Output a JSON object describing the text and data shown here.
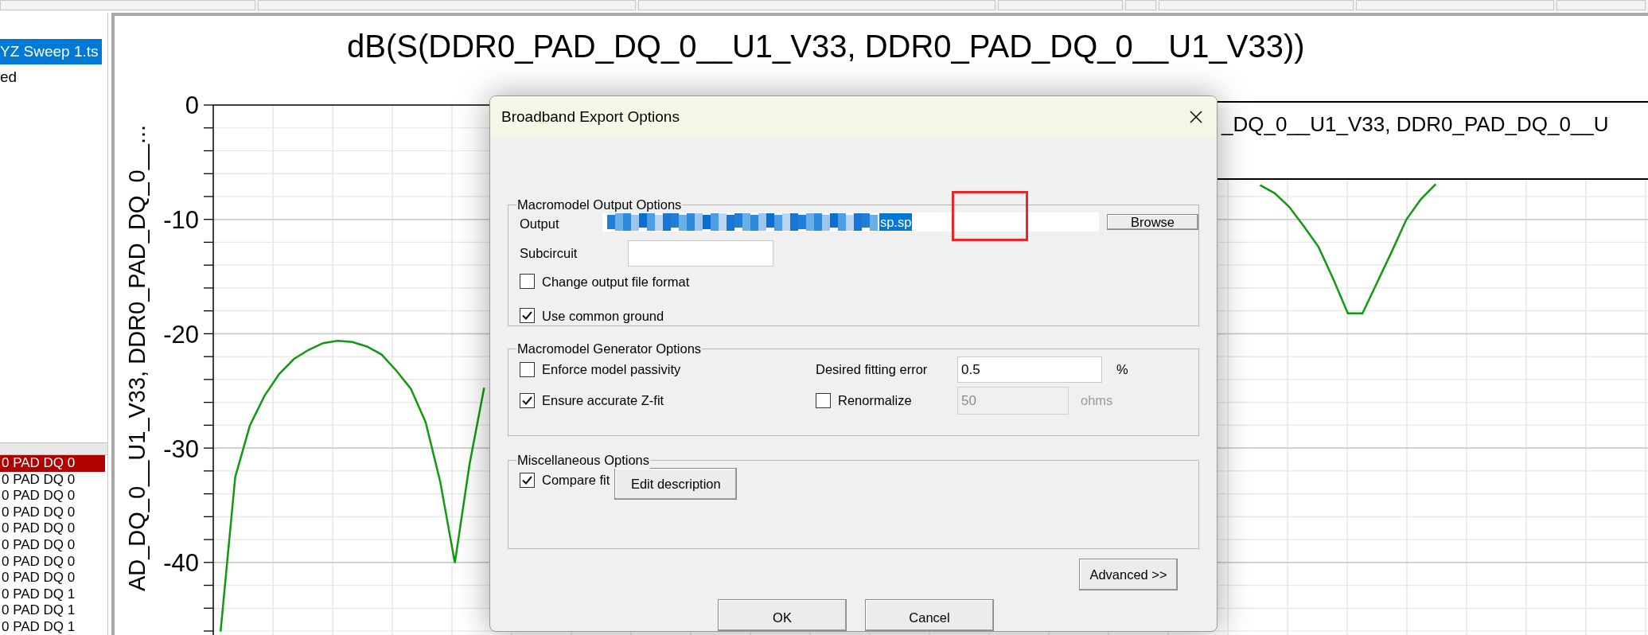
{
  "sidebar": {
    "items": [
      {
        "label": "YZ Sweep 1.ts",
        "selected": true
      },
      {
        "label": "ed",
        "selected": false
      }
    ]
  },
  "net_list": {
    "items": [
      {
        "label": "0 PAD DQ 0",
        "selected": true
      },
      {
        "label": "0 PAD DQ 0",
        "selected": false
      },
      {
        "label": "0 PAD DQ 0",
        "selected": false
      },
      {
        "label": "0 PAD DQ 0",
        "selected": false
      },
      {
        "label": "0 PAD DQ 0",
        "selected": false
      },
      {
        "label": "0 PAD DQ 0",
        "selected": false
      },
      {
        "label": "0 PAD DQ 0",
        "selected": false
      },
      {
        "label": "0 PAD DQ 0",
        "selected": false
      },
      {
        "label": "0 PAD DQ 1",
        "selected": false
      },
      {
        "label": "0 PAD DQ 1",
        "selected": false
      },
      {
        "label": "0 PAD DQ 1",
        "selected": false
      }
    ]
  },
  "chart": {
    "chart_data": {
      "type": "line",
      "title": "dB(S(DDR0_PAD_DQ_0__U1_V33, DDR0_PAD_DQ_0__U1_V33))",
      "ylabel": "AD_DQ_0__U1_V33, DDR0_PAD_DQ_0__...",
      "ylim": [
        -46.3,
        0
      ],
      "yticks": [
        0,
        -10,
        -20,
        -30,
        -40
      ],
      "grid": true,
      "categories": [
        null,
        null,
        null,
        null,
        null,
        null,
        null,
        null,
        null,
        null,
        null,
        null,
        null,
        null,
        null,
        null,
        null,
        null,
        null,
        null,
        null,
        null,
        null,
        null,
        null,
        null,
        null,
        null,
        null,
        null,
        null,
        null,
        null,
        null,
        null,
        null,
        null,
        null,
        null,
        null,
        null,
        null,
        null,
        null,
        null,
        null,
        null,
        null,
        null,
        null,
        null,
        null,
        null,
        null,
        null,
        null,
        null,
        null,
        null,
        null,
        null,
        null,
        null,
        null,
        null,
        null,
        null,
        null,
        null,
        null,
        null,
        null,
        null,
        null,
        null,
        null,
        null,
        null,
        null,
        null,
        null,
        null,
        null,
        null,
        null,
        null,
        null,
        null,
        null,
        null,
        null,
        null,
        null,
        null,
        null,
        null,
        null,
        null
      ],
      "series": [
        {
          "name": "_DQ_0__U1_V33, DDR0_PAD_DQ_0__U",
          "color": "#119911",
          "values": [
            -46,
            -32.5,
            -28,
            -25.4,
            -23.5,
            -22.2,
            -21.4,
            -20.8,
            -20.6,
            -20.7,
            -21.1,
            -21.8,
            -23.2,
            -24.8,
            -27.7,
            -32.9,
            -40,
            -31.4,
            -24.7,
            null,
            null,
            null,
            null,
            null,
            null,
            null,
            null,
            null,
            null,
            null,
            null,
            null,
            null,
            null,
            null,
            null,
            null,
            null,
            null,
            null,
            null,
            null,
            null,
            null,
            null,
            null,
            null,
            null,
            null,
            null,
            null,
            null,
            null,
            null,
            null,
            null,
            null,
            null,
            null,
            null,
            null,
            null,
            null,
            null,
            null,
            null,
            null,
            null,
            null,
            null,
            null,
            null,
            null,
            null,
            null,
            null,
            null,
            null,
            null,
            null,
            null,
            null,
            null,
            null,
            null,
            null,
            null,
            null,
            null,
            null,
            null,
            null,
            null,
            null,
            null,
            null,
            null,
            null
          ]
        },
        {
          "color": "#119911",
          "values": [
            null,
            null,
            null,
            null,
            null,
            null,
            null,
            null,
            null,
            null,
            null,
            null,
            null,
            null,
            null,
            null,
            null,
            null,
            null,
            null,
            null,
            null,
            null,
            null,
            null,
            null,
            null,
            null,
            null,
            null,
            null,
            null,
            null,
            null,
            null,
            null,
            null,
            null,
            null,
            null,
            null,
            null,
            null,
            null,
            null,
            null,
            null,
            null,
            null,
            null,
            null,
            null,
            null,
            null,
            null,
            null,
            null,
            null,
            null,
            null,
            null,
            null,
            null,
            null,
            null,
            null,
            null,
            null,
            null,
            null,
            null,
            -7,
            -7.7,
            -8.9,
            -10.6,
            -12.4,
            -15.2,
            -18.2,
            -18.2,
            -15.5,
            -12.8,
            -10,
            -8.2,
            -6.9,
            null,
            null,
            null,
            null,
            null,
            null,
            null,
            null,
            null,
            null,
            null,
            null,
            null,
            null
          ]
        }
      ]
    }
  },
  "dialog": {
    "title": "Broadband Export Options",
    "output_group": {
      "title": "Macromodel Output Options",
      "output_label": "Output",
      "output_value": "sp.sp",
      "value_selected": true,
      "browse": "Browse",
      "subcircuit_label": "Subcircuit",
      "checkboxes": [
        {
          "label": "Change output file format",
          "checked": false
        },
        {
          "label": "Use common ground",
          "checked": true
        }
      ]
    },
    "generator_group": {
      "title": "Macromodel Generator Options",
      "checkboxes": [
        {
          "label": "Enforce model passivity",
          "checked": false
        },
        {
          "label": "Ensure accurate Z-fit",
          "checked": true
        }
      ],
      "fitting_error": {
        "label": "Desired fitting error",
        "value": "0.5",
        "unit": "%"
      },
      "renormalize": {
        "label": "Renormalize",
        "checked": false,
        "value": "50",
        "unit": "ohms",
        "disabled": true
      }
    },
    "misc_group": {
      "title": "Miscellaneous Options",
      "compare_fit": {
        "label": "Compare fit",
        "checked": true
      },
      "edit_button": "Edit description"
    },
    "advanced_button": "Advanced >>",
    "buttons": [
      "OK",
      "Cancel"
    ]
  }
}
